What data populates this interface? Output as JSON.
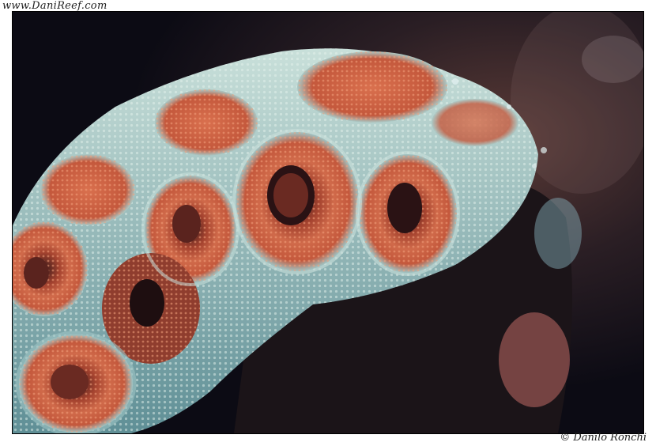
{
  "header": {
    "site_url": "www.DaniReef.com"
  },
  "footer": {
    "credit": "© Danilo Ronchi"
  },
  "photo": {
    "subject_icon": "coral-photo",
    "colors": {
      "background": "#0c0b14",
      "polyp_orange": "#c4583c",
      "polyp_rim": "#e07a55",
      "tissue_teal": "#8fb7b8",
      "tissue_highlight": "#c9e0da",
      "rock_dark": "#1b1418",
      "right_glow": "#6a3f3a"
    }
  }
}
